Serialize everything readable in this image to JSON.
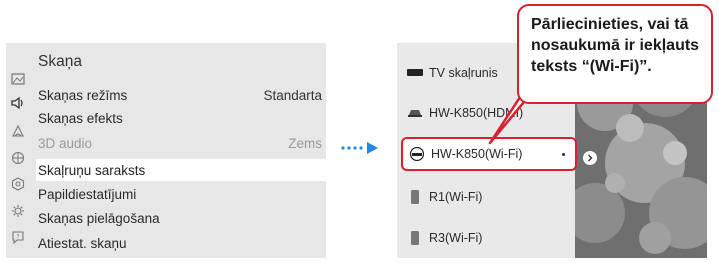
{
  "sound_menu": {
    "title": "Skaņa",
    "items": [
      {
        "label": "Skaņas režīms",
        "value": "Standarta",
        "state": "normal"
      },
      {
        "label": "Skaņas efekts",
        "value": "",
        "state": "normal"
      },
      {
        "label": "3D audio",
        "value": "Zems",
        "state": "disabled"
      },
      {
        "label": "Skaļruņu saraksts",
        "value": "",
        "state": "selected"
      },
      {
        "label": "Papildiestatījumi",
        "value": "",
        "state": "normal"
      },
      {
        "label": "Skaņas pielāgošana",
        "value": "",
        "state": "normal"
      },
      {
        "label": "Atiestat. skaņu",
        "value": "",
        "state": "normal"
      }
    ],
    "sidebar_icons": [
      "picture-icon",
      "sound-icon",
      "broadcast-icon",
      "network-icon",
      "system-icon",
      "support-icon",
      "help-icon"
    ]
  },
  "speaker_list": {
    "items": [
      {
        "label": "TV skaļrunis",
        "icon": "tv-speaker-icon"
      },
      {
        "label": "HW-K850(HDMI)",
        "icon": "soundbar-icon"
      },
      {
        "label": "HW-K850(Wi-Fi)",
        "icon": "soundbar-icon",
        "highlighted": true
      },
      {
        "label": "R1(Wi-Fi)",
        "icon": "speaker-icon"
      },
      {
        "label": "R3(Wi-Fi)",
        "icon": "speaker-icon"
      }
    ]
  },
  "callout": {
    "text": "Pārliecinieties, vai tā nosaukumā ir iekļauts teksts “(Wi-Fi)”."
  },
  "colors": {
    "highlight_red": "#d9202f",
    "arrow_blue": "#1e88e5",
    "panel_gray": "#e7e7e7"
  }
}
